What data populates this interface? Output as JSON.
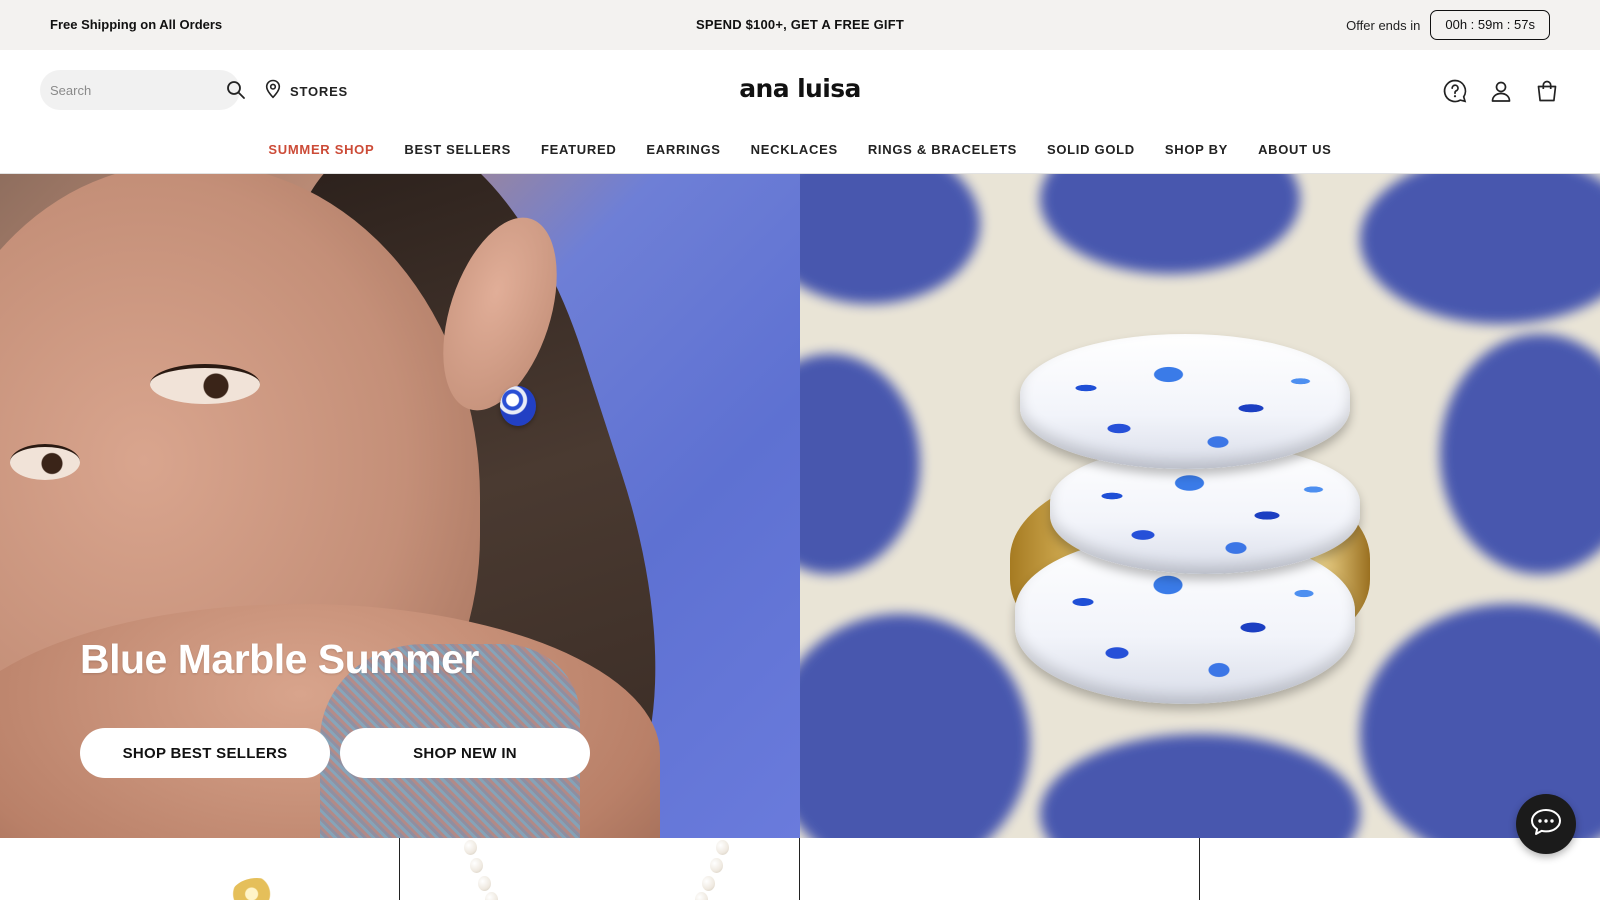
{
  "announcement": {
    "left_text": "Free Shipping on All Orders",
    "center_text": "SPEND $100+, GET A FREE GIFT",
    "offer_label": "Offer ends in",
    "timer": "00h : 59m : 57s"
  },
  "header": {
    "search_placeholder": "Search",
    "stores_label": "STORES",
    "logo": "ana luisa",
    "icons": [
      "help-icon",
      "account-icon",
      "cart-icon"
    ]
  },
  "nav": {
    "items": [
      {
        "label": "SUMMER SHOP",
        "active": true
      },
      {
        "label": "BEST SELLERS"
      },
      {
        "label": "FEATURED"
      },
      {
        "label": "EARRINGS"
      },
      {
        "label": "NECKLACES"
      },
      {
        "label": "RINGS & BRACELETS"
      },
      {
        "label": "SOLID GOLD"
      },
      {
        "label": "SHOP BY"
      },
      {
        "label": "ABOUT US"
      }
    ]
  },
  "hero": {
    "title": "Blue Marble Summer",
    "buttons": [
      "SHOP BEST SELLERS",
      "SHOP NEW IN"
    ]
  },
  "colors": {
    "accent": "#cc4b37",
    "announcement_bg": "#f3f2f0",
    "hero_blue": "#5e71d2"
  }
}
